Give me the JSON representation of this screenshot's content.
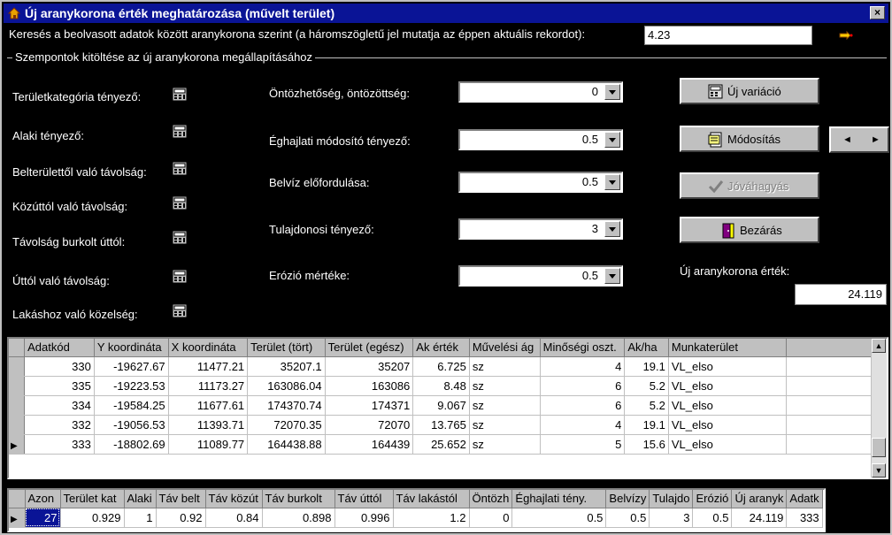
{
  "window": {
    "title": "Új aranykorona érték meghatározása (művelt terület)",
    "close_label": "×"
  },
  "search": {
    "label": "Keresés a beolvasott adatok között aranykorona szerint (a háromszögletű jel mutatja az éppen aktuális rekordot):",
    "value": "4.23"
  },
  "group_label": "Szempontok kitöltése az új aranykorona megállapításához",
  "left_factors": [
    "Területkategória tényező:",
    "Alaki tényező:",
    "Belterülettől való távolság:",
    "Közúttól való távolság:",
    "Távolság burkolt úttól:",
    "Úttól való távolság:",
    "Lakáshoz való közelség:"
  ],
  "combos": [
    {
      "label": "Öntözhetőség, öntözöttség:",
      "value": "0"
    },
    {
      "label": "Éghajlati módosító tényező:",
      "value": "0.5"
    },
    {
      "label": "Belvíz előfordulása:",
      "value": "0.5"
    },
    {
      "label": "Tulajdonosi tényező:",
      "value": "3"
    },
    {
      "label": "Erózió mértéke:",
      "value": "0.5"
    }
  ],
  "buttons": {
    "new_variation": "Új variáció",
    "modify": "Módosítás",
    "approve": "Jóváhagyás",
    "close": "Bezárás",
    "prev": "◄",
    "next": "►"
  },
  "result": {
    "label": "Új aranykorona érték:",
    "value": "24.119"
  },
  "upper_grid": {
    "columns": [
      "Adatkód",
      "Y koordináta",
      "X koordináta",
      "Terület (tört)",
      "Terület (egész)",
      "Ak érték",
      "Művelési ág",
      "Minőségi oszt.",
      "Ak/ha",
      "Munkaterület"
    ],
    "rows": [
      [
        "330",
        "-19627.67",
        "11477.21",
        "35207.1",
        "35207",
        "6.725",
        "sz",
        "4",
        "19.1",
        "VL_elso"
      ],
      [
        "335",
        "-19223.53",
        "11173.27",
        "163086.04",
        "163086",
        "8.48",
        "sz",
        "6",
        "5.2",
        "VL_elso"
      ],
      [
        "334",
        "-19584.25",
        "11677.61",
        "174370.74",
        "174371",
        "9.067",
        "sz",
        "6",
        "5.2",
        "VL_elso"
      ],
      [
        "332",
        "-19056.53",
        "11393.71",
        "72070.35",
        "72070",
        "13.765",
        "sz",
        "4",
        "19.1",
        "VL_elso"
      ],
      [
        "333",
        "-18802.69",
        "11089.77",
        "164438.88",
        "164439",
        "25.652",
        "sz",
        "5",
        "15.6",
        "VL_elso"
      ]
    ],
    "current_row": 4
  },
  "lower_grid": {
    "columns": [
      "Azon",
      "Terület kat",
      "Alaki",
      "Táv belt",
      "Táv közút",
      "Táv burkolt",
      "Táv úttól",
      "Táv lakástól",
      "Öntözh",
      "Éghajlati tény.",
      "Belvízy",
      "Tulajdo",
      "Erózió",
      "Új aranyk",
      "Adatk"
    ],
    "row": [
      "27",
      "0.929",
      "1",
      "0.92",
      "0.84",
      "0.898",
      "0.996",
      "1.2",
      "0",
      "0.5",
      "0.5",
      "3",
      "0.5",
      "24.119",
      "333"
    ]
  }
}
